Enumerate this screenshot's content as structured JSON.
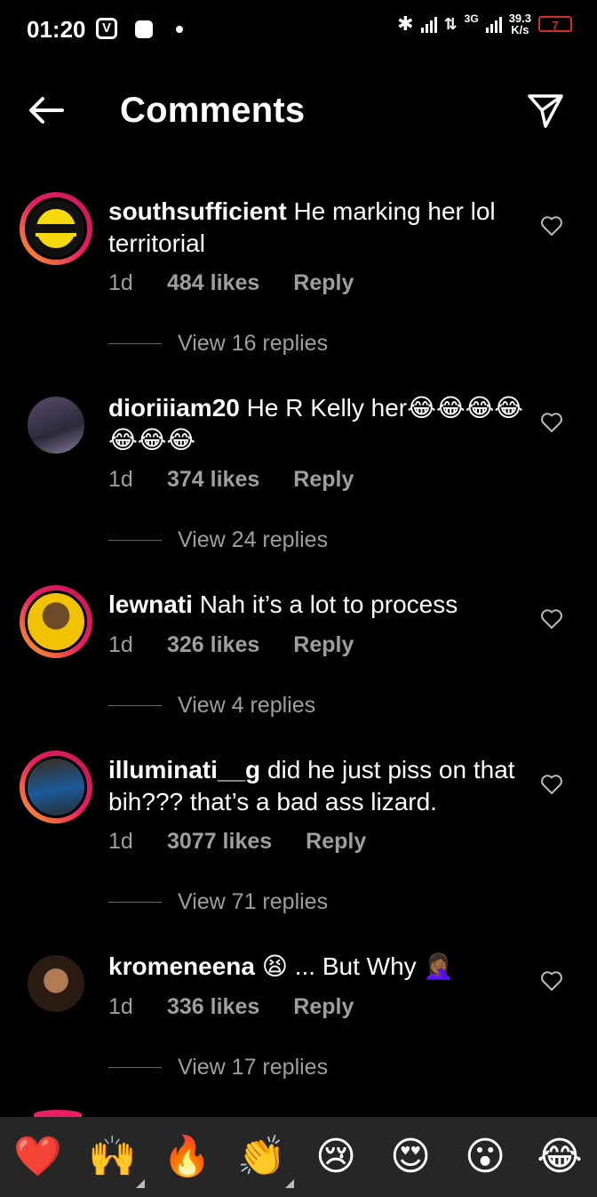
{
  "status": {
    "time": "01:20",
    "network": "3G",
    "speed_value": "39.3",
    "speed_unit": "K/s",
    "battery": "7"
  },
  "header": {
    "title": "Comments",
    "back_icon": "back-arrow-icon",
    "send_icon": "send-icon"
  },
  "comments": [
    {
      "user": "southsufficient",
      "text": "He marking her lol territorial",
      "time": "1d",
      "likes": "484 likes",
      "reply": "Reply",
      "view_replies": "View 16 replies"
    },
    {
      "user": "dioriiiam20",
      "text": "He R Kelly her😂😂😂😂😂😂😂",
      "time": "1d",
      "likes": "374 likes",
      "reply": "Reply",
      "view_replies": "View 24 replies"
    },
    {
      "user": "lewnati",
      "text": "Nah it’s a lot to process",
      "time": "1d",
      "likes": "326 likes",
      "reply": "Reply",
      "view_replies": "View 4 replies"
    },
    {
      "user": "illuminati__g",
      "text": "did he just piss on that bih??? that’s a bad ass lizard.",
      "time": "1d",
      "likes": "3077 likes",
      "reply": "Reply",
      "view_replies": "View 71 replies"
    },
    {
      "user": "kromeneena",
      "text": "😫 ... But Why 🤦🏾‍♀️",
      "time": "1d",
      "likes": "336 likes",
      "reply": "Reply",
      "view_replies": "View 17 replies"
    }
  ],
  "reactions": [
    "❤️",
    "🙌",
    "🔥",
    "👏",
    "😢",
    "😍",
    "😮",
    "😂"
  ],
  "colors": {
    "background": "#000000",
    "muted": "#9e9e9e",
    "ring_start": "#f9a825",
    "ring_end": "#c2185b",
    "bar": "#262626"
  }
}
